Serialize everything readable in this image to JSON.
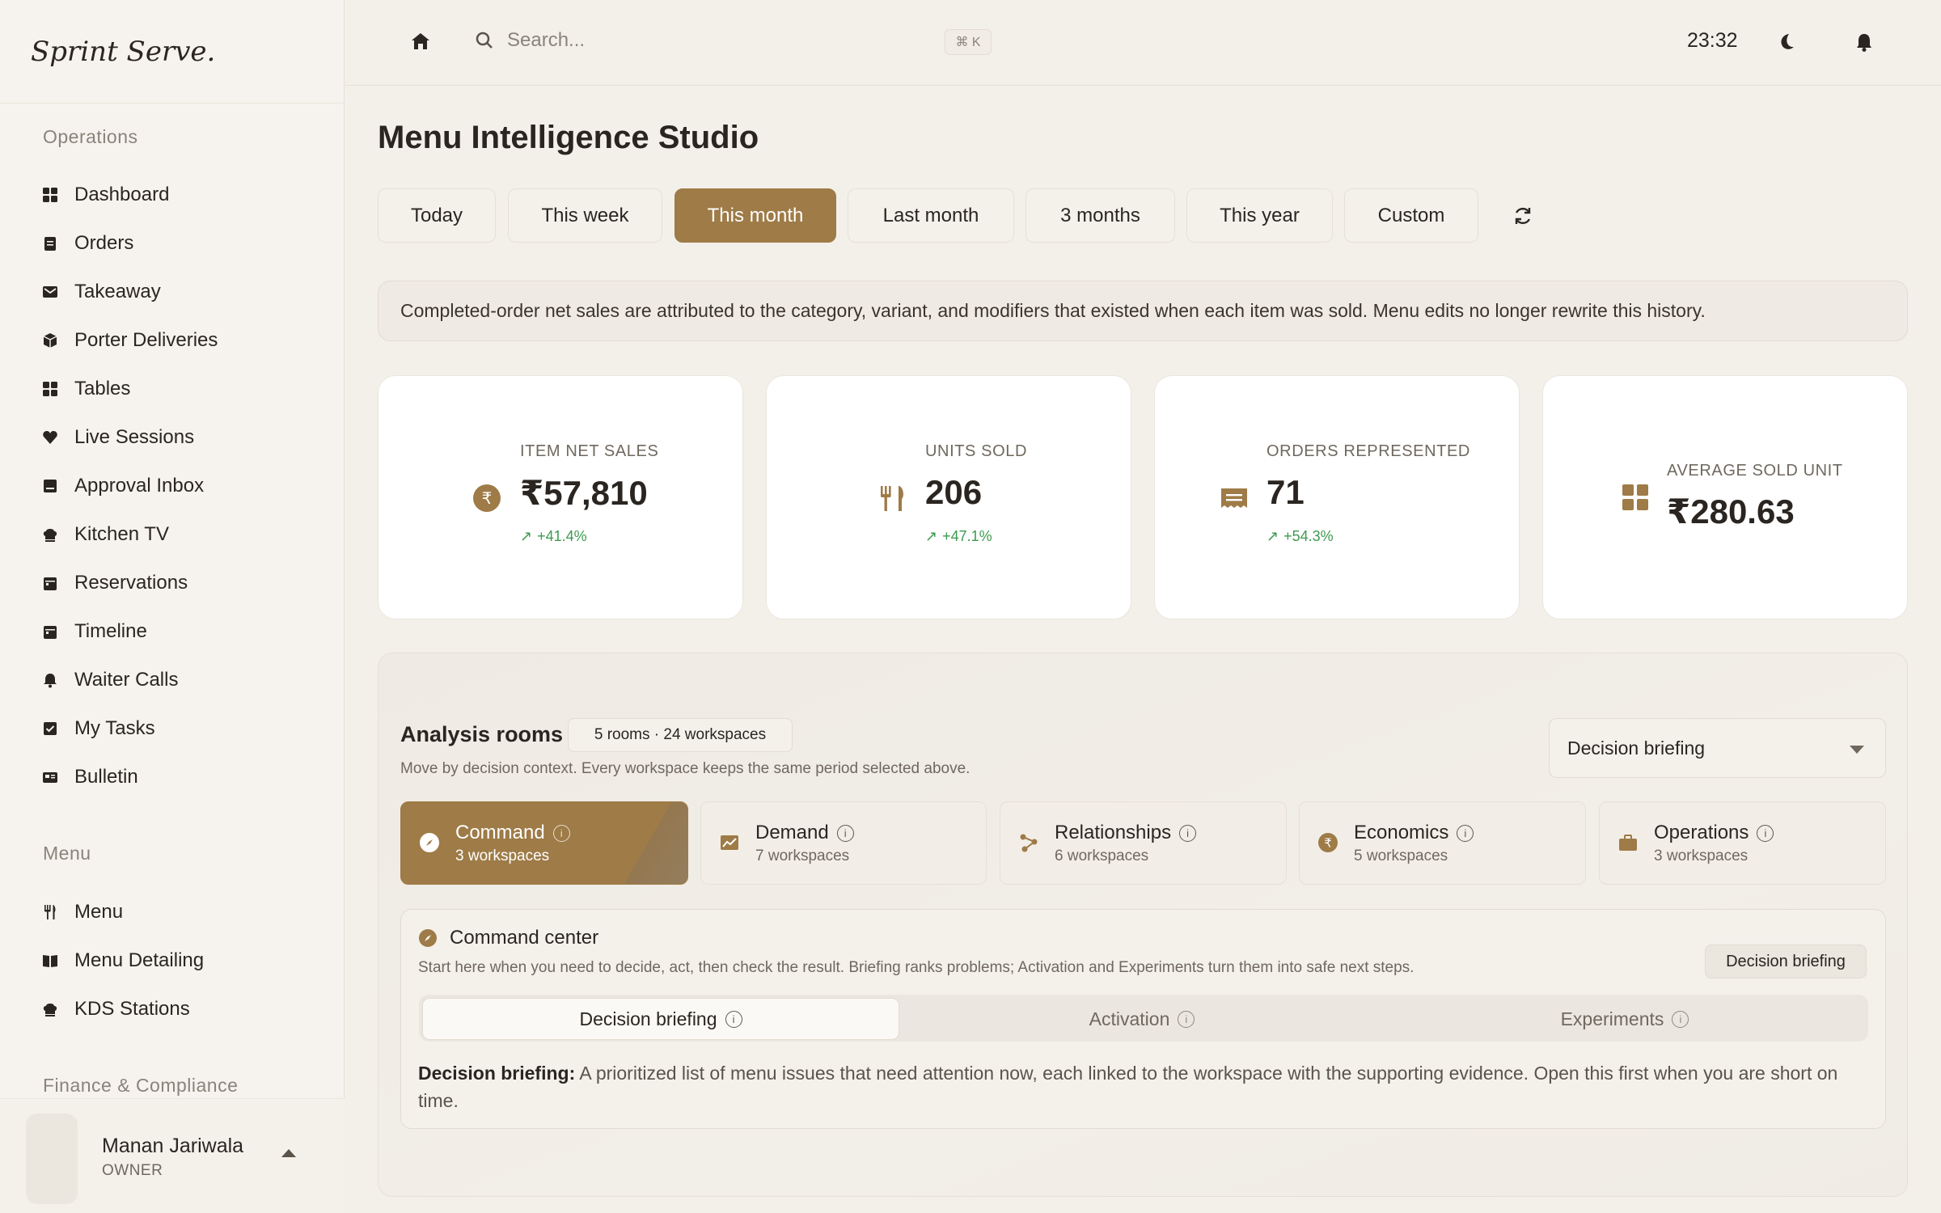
{
  "brand": "Sprint Serve.",
  "sidebar": {
    "sections": [
      {
        "title": "Operations",
        "items": [
          {
            "label": "Dashboard",
            "icon": "grid-icon"
          },
          {
            "label": "Orders",
            "icon": "clipboard-icon"
          },
          {
            "label": "Takeaway",
            "icon": "mail-icon"
          },
          {
            "label": "Porter Deliveries",
            "icon": "package-icon"
          },
          {
            "label": "Tables",
            "icon": "grid-icon"
          },
          {
            "label": "Live Sessions",
            "icon": "heart-icon"
          },
          {
            "label": "Approval Inbox",
            "icon": "inbox-icon"
          },
          {
            "label": "Kitchen TV",
            "icon": "chef-hat-icon"
          },
          {
            "label": "Reservations",
            "icon": "calendar-icon"
          },
          {
            "label": "Timeline",
            "icon": "calendar-icon"
          },
          {
            "label": "Waiter Calls",
            "icon": "bell-icon"
          },
          {
            "label": "My Tasks",
            "icon": "checkbox-icon"
          },
          {
            "label": "Bulletin",
            "icon": "newspaper-icon"
          }
        ]
      },
      {
        "title": "Menu",
        "items": [
          {
            "label": "Menu",
            "icon": "utensils-icon"
          },
          {
            "label": "Menu Detailing",
            "icon": "book-icon"
          },
          {
            "label": "KDS Stations",
            "icon": "chef-hat-icon"
          }
        ]
      },
      {
        "title": "Finance & Compliance",
        "items": []
      }
    ],
    "user": {
      "name": "Manan Jariwala",
      "role": "OWNER"
    }
  },
  "topbar": {
    "search_placeholder": "Search...",
    "shortcut": "⌘ K",
    "clock": "23:32"
  },
  "page": {
    "title": "Menu Intelligence Studio",
    "periods": [
      "Today",
      "This week",
      "This month",
      "Last month",
      "3 months",
      "This year",
      "Custom"
    ],
    "active_period": "This month",
    "banner": "Completed-order net sales are attributed to the category, variant, and modifiers that existed when each item was sold. Menu edits no longer rewrite this history."
  },
  "kpis": [
    {
      "label": "ITEM NET SALES",
      "value": "₹57,810",
      "trend": "+41.4%",
      "icon": "rupee-coin-icon"
    },
    {
      "label": "UNITS SOLD",
      "value": "206",
      "trend": "+47.1%",
      "icon": "utensils-icon"
    },
    {
      "label": "ORDERS REPRESENTED",
      "value": "71",
      "trend": "+54.3%",
      "icon": "receipt-icon"
    },
    {
      "label": "AVERAGE SOLD UNIT",
      "value": "₹280.63",
      "trend": "",
      "icon": "grid-icon"
    }
  ],
  "analysis": {
    "title": "Analysis rooms",
    "badge": "5 rooms · 24 workspaces",
    "subtitle": "Move by decision context. Every workspace keeps the same period selected above.",
    "select_value": "Decision briefing",
    "rooms": [
      {
        "name": "Command",
        "sub": "3 workspaces",
        "icon": "compass-icon"
      },
      {
        "name": "Demand",
        "sub": "7 workspaces",
        "icon": "chart-icon"
      },
      {
        "name": "Relationships",
        "sub": "6 workspaces",
        "icon": "network-icon"
      },
      {
        "name": "Economics",
        "sub": "5 workspaces",
        "icon": "rupee-coin-icon"
      },
      {
        "name": "Operations",
        "sub": "3 workspaces",
        "icon": "briefcase-icon"
      }
    ],
    "command_center": {
      "title": "Command center",
      "subtitle": "Start here when you need to decide, act, then check the result. Briefing ranks problems; Activation and Experiments turn them into safe next steps.",
      "pill": "Decision briefing",
      "tabs": [
        "Decision briefing",
        "Activation",
        "Experiments"
      ],
      "desc_label": "Decision briefing:",
      "desc_text": " A prioritized list of menu issues that need attention now, each linked to the workspace with the supporting evidence. Open this first when you are short on time."
    }
  },
  "colors": {
    "accent": "#9e7b47",
    "positive": "#3d9a4f",
    "background": "#f3f0ea"
  }
}
